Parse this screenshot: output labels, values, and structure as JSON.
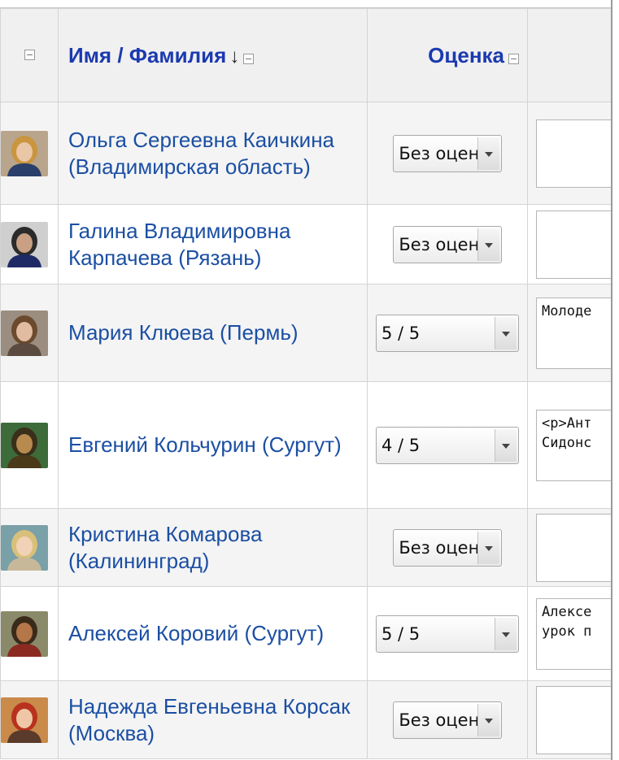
{
  "header": {
    "name_column": "Имя / Фамилия",
    "sort_arrow": "↓",
    "grade_column": "Оценка"
  },
  "rows": [
    {
      "name": "Ольга Сергеевна Каичкина (Владимирская область)",
      "grade": "Без оценки",
      "comment": ""
    },
    {
      "name": "Галина Владимировна Карпачева (Рязань)",
      "grade": "Без оценки",
      "comment": ""
    },
    {
      "name": "Мария Клюева (Пермь)",
      "grade": "5 / 5",
      "comment": "Молоде"
    },
    {
      "name": "Евгений Кольчурин (Сургут)",
      "grade": "4 / 5",
      "comment": "<p>Ант\nСидонс"
    },
    {
      "name": "Кристина Комарова (Калининград)",
      "grade": "Без оценки",
      "comment": ""
    },
    {
      "name": "Алексей Коровий (Сургут)",
      "grade": "5 / 5",
      "comment": "Алексе\nурок п"
    },
    {
      "name": "Надежда Евгеньевна Корсак (Москва)",
      "grade": "Без оценки",
      "comment": ""
    }
  ],
  "avatar_colors": [
    {
      "bg": "#b9a48c",
      "hair": "#c9953e",
      "skin": "#e8c6a6",
      "clothes": "#2a3f6a"
    },
    {
      "bg": "#cfcfcf",
      "hair": "#2b2b2b",
      "skin": "#c9a083",
      "clothes": "#1e2a66"
    },
    {
      "bg": "#9b8e80",
      "hair": "#6b4a2e",
      "skin": "#e2bca0",
      "clothes": "#5a4a40"
    },
    {
      "bg": "#3d6b3a",
      "hair": "#3a2f1a",
      "skin": "#b78a50",
      "clothes": "#4a3a1a"
    },
    {
      "bg": "#7aa0a8",
      "hair": "#d9c07a",
      "skin": "#f0d3b6",
      "clothes": "#c8b89a"
    },
    {
      "bg": "#8a8a6a",
      "hair": "#3a2a1a",
      "skin": "#b5764a",
      "clothes": "#8b2a20"
    },
    {
      "bg": "#c98a4a",
      "hair": "#b8321e",
      "skin": "#efc7a7",
      "clothes": "#5a3a2a"
    }
  ]
}
